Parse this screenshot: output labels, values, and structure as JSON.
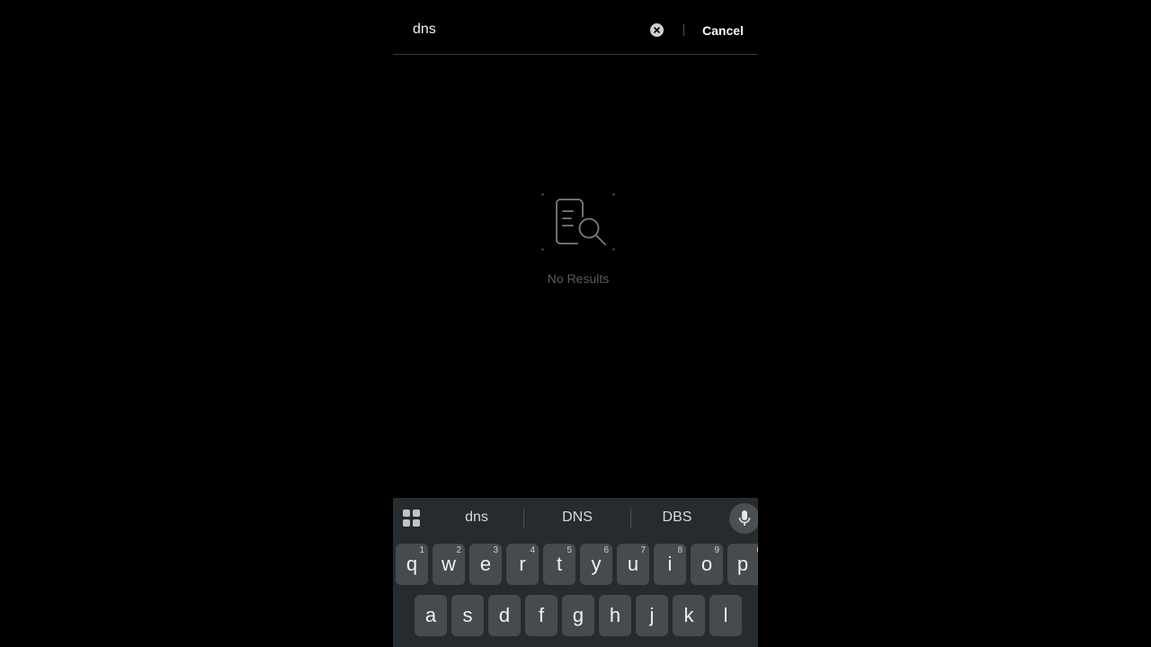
{
  "search": {
    "value": "dns",
    "cancel_label": "Cancel"
  },
  "empty_state": {
    "icon": "document-search-icon",
    "text": "No Results"
  },
  "keyboard": {
    "suggestions": [
      "dns",
      "DNS",
      "DBS"
    ],
    "row1": [
      {
        "key": "q",
        "num": "1"
      },
      {
        "key": "w",
        "num": "2"
      },
      {
        "key": "e",
        "num": "3"
      },
      {
        "key": "r",
        "num": "4"
      },
      {
        "key": "t",
        "num": "5"
      },
      {
        "key": "y",
        "num": "6"
      },
      {
        "key": "u",
        "num": "7"
      },
      {
        "key": "i",
        "num": "8"
      },
      {
        "key": "o",
        "num": "9"
      },
      {
        "key": "p",
        "num": "0"
      }
    ],
    "row2": [
      "a",
      "s",
      "d",
      "f",
      "g",
      "h",
      "j",
      "k",
      "l"
    ]
  },
  "colors": {
    "background": "#000000",
    "keyboard_bg": "#262b2f",
    "key_bg": "#464b50",
    "muted_text": "#5a5a5a"
  }
}
